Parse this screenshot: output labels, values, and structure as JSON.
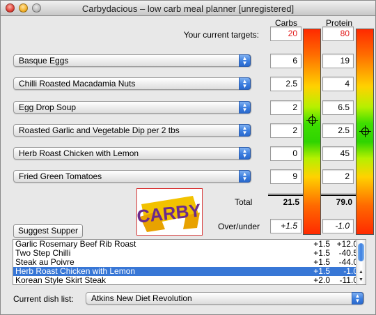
{
  "window": {
    "title": "Carbydacious – low carb meal planner [unregistered]"
  },
  "headers": {
    "carbs": "Carbs",
    "protein": "Protein"
  },
  "targets": {
    "label": "Your current targets:",
    "carbs": "20",
    "protein": "80"
  },
  "meals": [
    {
      "name": "Basque Eggs",
      "carbs": "6",
      "protein": "19"
    },
    {
      "name": "Chilli Roasted Macadamia Nuts",
      "carbs": "2.5",
      "protein": "4"
    },
    {
      "name": "Egg Drop Soup",
      "carbs": "2",
      "protein": "6.5"
    },
    {
      "name": "Roasted Garlic and Vegetable Dip per 2 tbs",
      "carbs": "2",
      "protein": "2.5"
    },
    {
      "name": "Herb Roast Chicken with Lemon",
      "carbs": "0",
      "protein": "45"
    },
    {
      "name": "Fried Green Tomatoes",
      "carbs": "9",
      "protein": "2"
    }
  ],
  "total": {
    "label": "Total",
    "carbs": "21.5",
    "protein": "79.0"
  },
  "overunder": {
    "label": "Over/under",
    "carbs": "+1.5",
    "protein": "-1.0"
  },
  "logo": {
    "text": "CARBY"
  },
  "suggest": {
    "label": "Suggest Supper"
  },
  "suggestions": [
    {
      "name": "Garlic Rosemary Beef Rib Roast",
      "carbs": "+1.5",
      "protein": "+12.0",
      "selected": false
    },
    {
      "name": "Two Step Chilli",
      "carbs": "+1.5",
      "protein": "-40.5",
      "selected": false
    },
    {
      "name": "Steak au Poivre",
      "carbs": "+1.5",
      "protein": "-44.0",
      "selected": false
    },
    {
      "name": "Herb Roast Chicken with Lemon",
      "carbs": "+1.5",
      "protein": "-1.0",
      "selected": true
    },
    {
      "name": "Korean Style Skirt Steak",
      "carbs": "+2.0",
      "protein": "-11.0",
      "selected": false
    }
  ],
  "dishlist": {
    "label": "Current dish list:",
    "value": "Atkins New Diet Revolution"
  },
  "colors": {
    "target_red": "#e21b1b",
    "selection_blue": "#3877d6"
  },
  "icons": {
    "gauge_marker": "crosshair-icon",
    "popup_arrow": "up-down-arrows-icon"
  }
}
